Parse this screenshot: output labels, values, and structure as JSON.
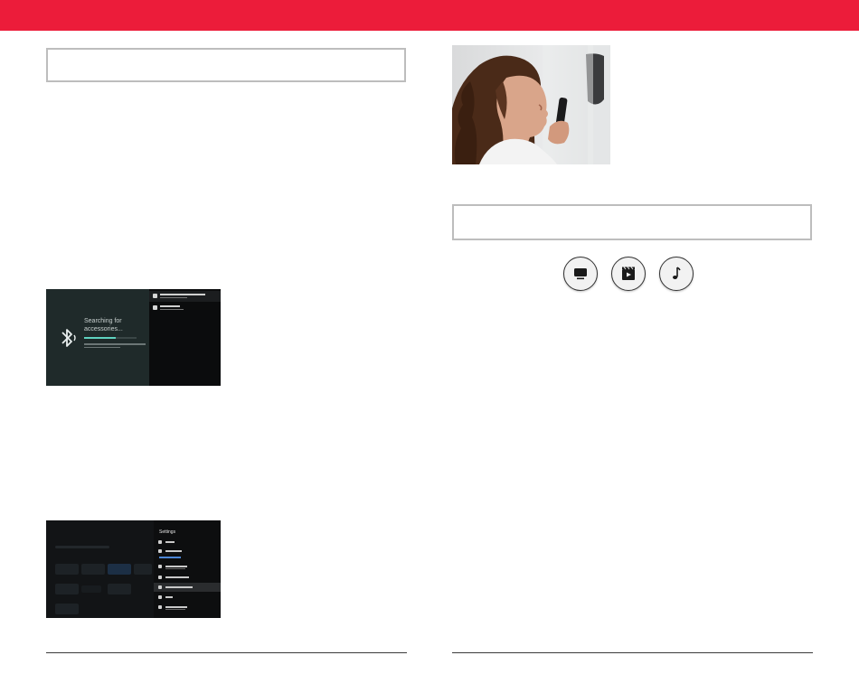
{
  "brand": {
    "accent": "#ec1c3a",
    "frame_gray": "#bdbdbd"
  },
  "bluetooth_screen": {
    "title": "Searching for accessories...",
    "progress": 0.6,
    "icon": "bluetooth-icon",
    "list_icons": [
      "bluetooth-icon",
      "remote-icon"
    ]
  },
  "settings_screen": {
    "title": "Settings",
    "selected_row_index": 6
  },
  "photo": {
    "subject": "woman-speaking-into-remote"
  },
  "media_icons": [
    {
      "name": "tv-icon"
    },
    {
      "name": "movie-icon"
    },
    {
      "name": "music-note-icon"
    }
  ]
}
